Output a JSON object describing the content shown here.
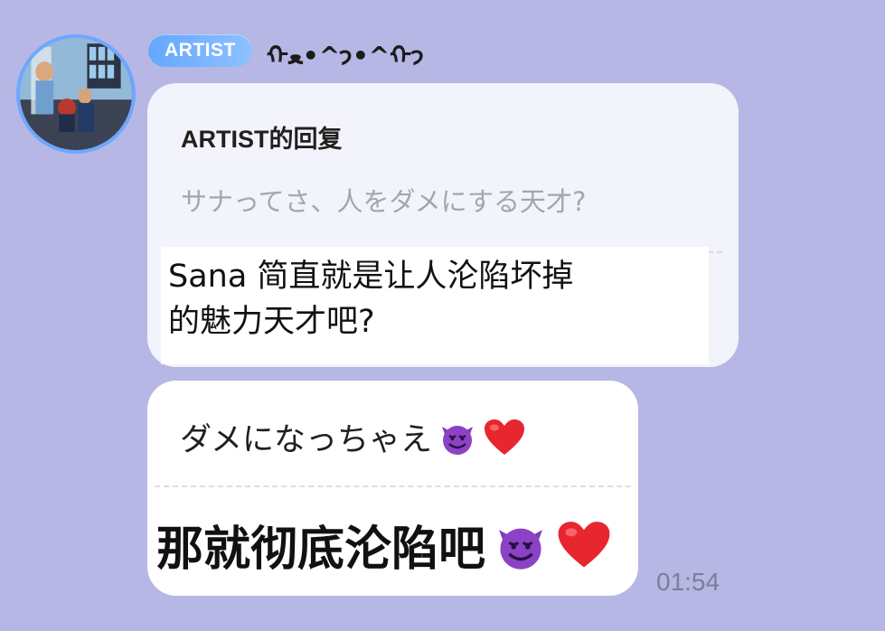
{
  "sender": {
    "badge": "ARTIST",
    "name": "ᡣ𐭩^•ﻌ•^ᡣ𐭩"
  },
  "reply_bubble": {
    "reply_label": "ARTIST的回复",
    "quoted_text": "サナってさ、人をダメにする天才?",
    "answer_line1": "Sana 简直就是让人沦陷坏掉",
    "answer_line2": "的魅力天才吧?"
  },
  "message_bubble": {
    "line1_text": "ダメになっちゃえ",
    "line2_text": "那就彻底沦陷吧"
  },
  "timestamp": "01:54",
  "colors": {
    "background": "#b6b7e5",
    "badge": "#63a7ff",
    "bubble": "#f3f3fb",
    "heart": "#e8262f",
    "devil": "#8b42c4"
  },
  "icons": {
    "devil": "smiling-face-with-horns-icon",
    "heart": "red-heart-icon"
  }
}
